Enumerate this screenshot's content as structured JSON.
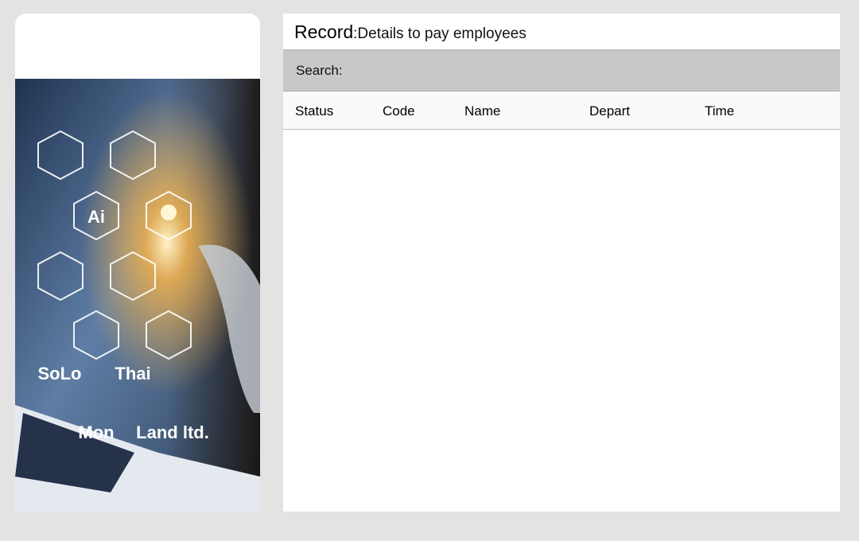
{
  "sidebar": {
    "image_alt": "AI technology hexagon icons with hand",
    "overlay_labels": [
      "SoLo",
      "Thai",
      "Mon",
      "Land ltd."
    ]
  },
  "header": {
    "title": "Record",
    "subtitle": ":Details to pay employees"
  },
  "search": {
    "label": "Search:",
    "value": "",
    "placeholder": ""
  },
  "table": {
    "columns": [
      "Status",
      "Code",
      "Name",
      "Depart",
      "Time"
    ],
    "rows": []
  },
  "colors": {
    "page_bg": "#e3e3e3",
    "search_bg": "#c8c8c8",
    "panel_bg": "#ffffff"
  }
}
